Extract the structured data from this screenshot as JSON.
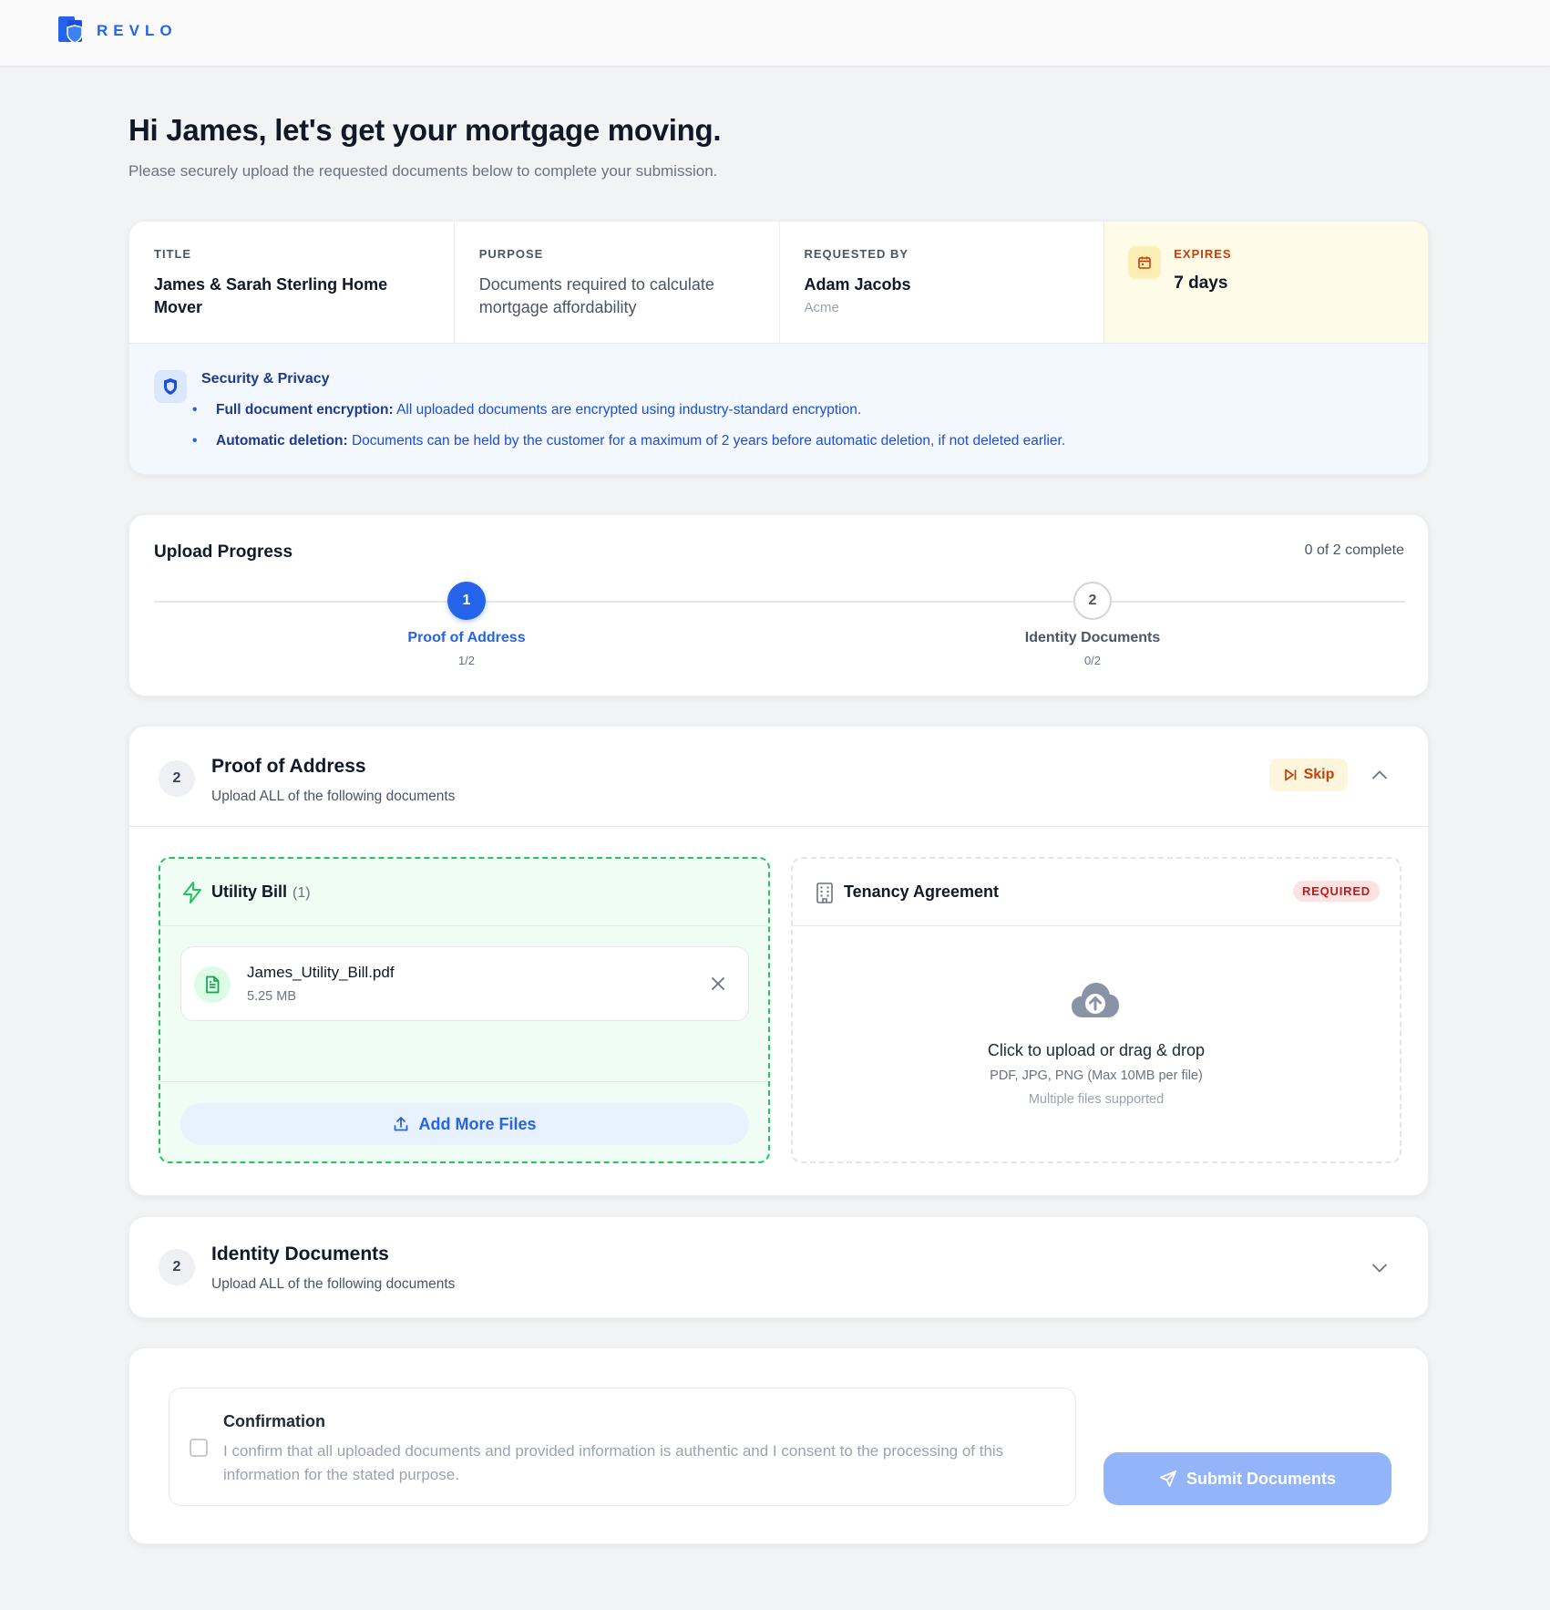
{
  "brand": {
    "name": "REVLO",
    "color": "#2563eb"
  },
  "header": {
    "title": "Hi James, let's get your mortgage moving.",
    "subtitle": "Please securely upload the requested documents below to complete your submission."
  },
  "request": {
    "title_label": "TITLE",
    "title_value": "James & Sarah Sterling Home Mover",
    "purpose_label": "PURPOSE",
    "purpose_value": "Documents required to calculate mortgage affordability",
    "requested_by_label": "REQUESTED BY",
    "requested_by_name": "Adam Jacobs",
    "requested_by_org": "Acme",
    "expires_label": "EXPIRES",
    "expires_value": "7 days",
    "expires_icon": "calendar-icon"
  },
  "security": {
    "title": "Security & Privacy",
    "icon": "shield-icon",
    "items": [
      {
        "bold": "Full document encryption:",
        "text": "All uploaded documents are encrypted using industry-standard encryption."
      },
      {
        "bold": "Automatic deletion:",
        "text": "Documents can be held by the customer for a maximum of 2 years before automatic deletion, if not deleted earlier."
      }
    ]
  },
  "progress": {
    "title": "Upload Progress",
    "count_text": "0 of 2 complete",
    "steps": [
      {
        "number": "1",
        "label": "Proof of Address",
        "count": "1/2",
        "state": "active"
      },
      {
        "number": "2",
        "label": "Identity Documents",
        "count": "0/2",
        "state": "idle"
      }
    ]
  },
  "sections": {
    "proof_of_address": {
      "badge": "2",
      "title": "Proof of Address",
      "subtitle": "Upload ALL of the following documents",
      "skip_label": "Skip",
      "expanded": true,
      "documents": {
        "utility_bill": {
          "title": "Utility Bill",
          "count": "(1)",
          "icon": "lightning-icon",
          "file": {
            "name": "James_Utility_Bill.pdf",
            "size": "5.25 MB",
            "icon": "file-text-icon"
          },
          "add_more_label": "Add More Files"
        },
        "tenancy_agreement": {
          "title": "Tenancy Agreement",
          "icon": "building-icon",
          "badge": "REQUIRED",
          "upload_main": "Click to upload or drag & drop",
          "upload_formats": "PDF, JPG, PNG (Max 10MB per file)",
          "upload_note": "Multiple files supported",
          "upload_icon": "cloud-upload-icon"
        }
      }
    },
    "identity_documents": {
      "badge": "2",
      "title": "Identity Documents",
      "subtitle": "Upload ALL of the following documents",
      "expanded": false
    }
  },
  "confirmation": {
    "title": "Confirmation",
    "text": "I confirm that all uploaded documents and provided information is authentic and I consent to the processing of this information for the stated purpose.",
    "checked": false,
    "submit_label": "Submit Documents",
    "submit_icon": "send-icon"
  },
  "colors": {
    "primary": "#2563eb",
    "success": "#22c55e",
    "warning": "#c2410c",
    "danger": "#b91c1c",
    "submit_disabled": "#93b4f8"
  }
}
